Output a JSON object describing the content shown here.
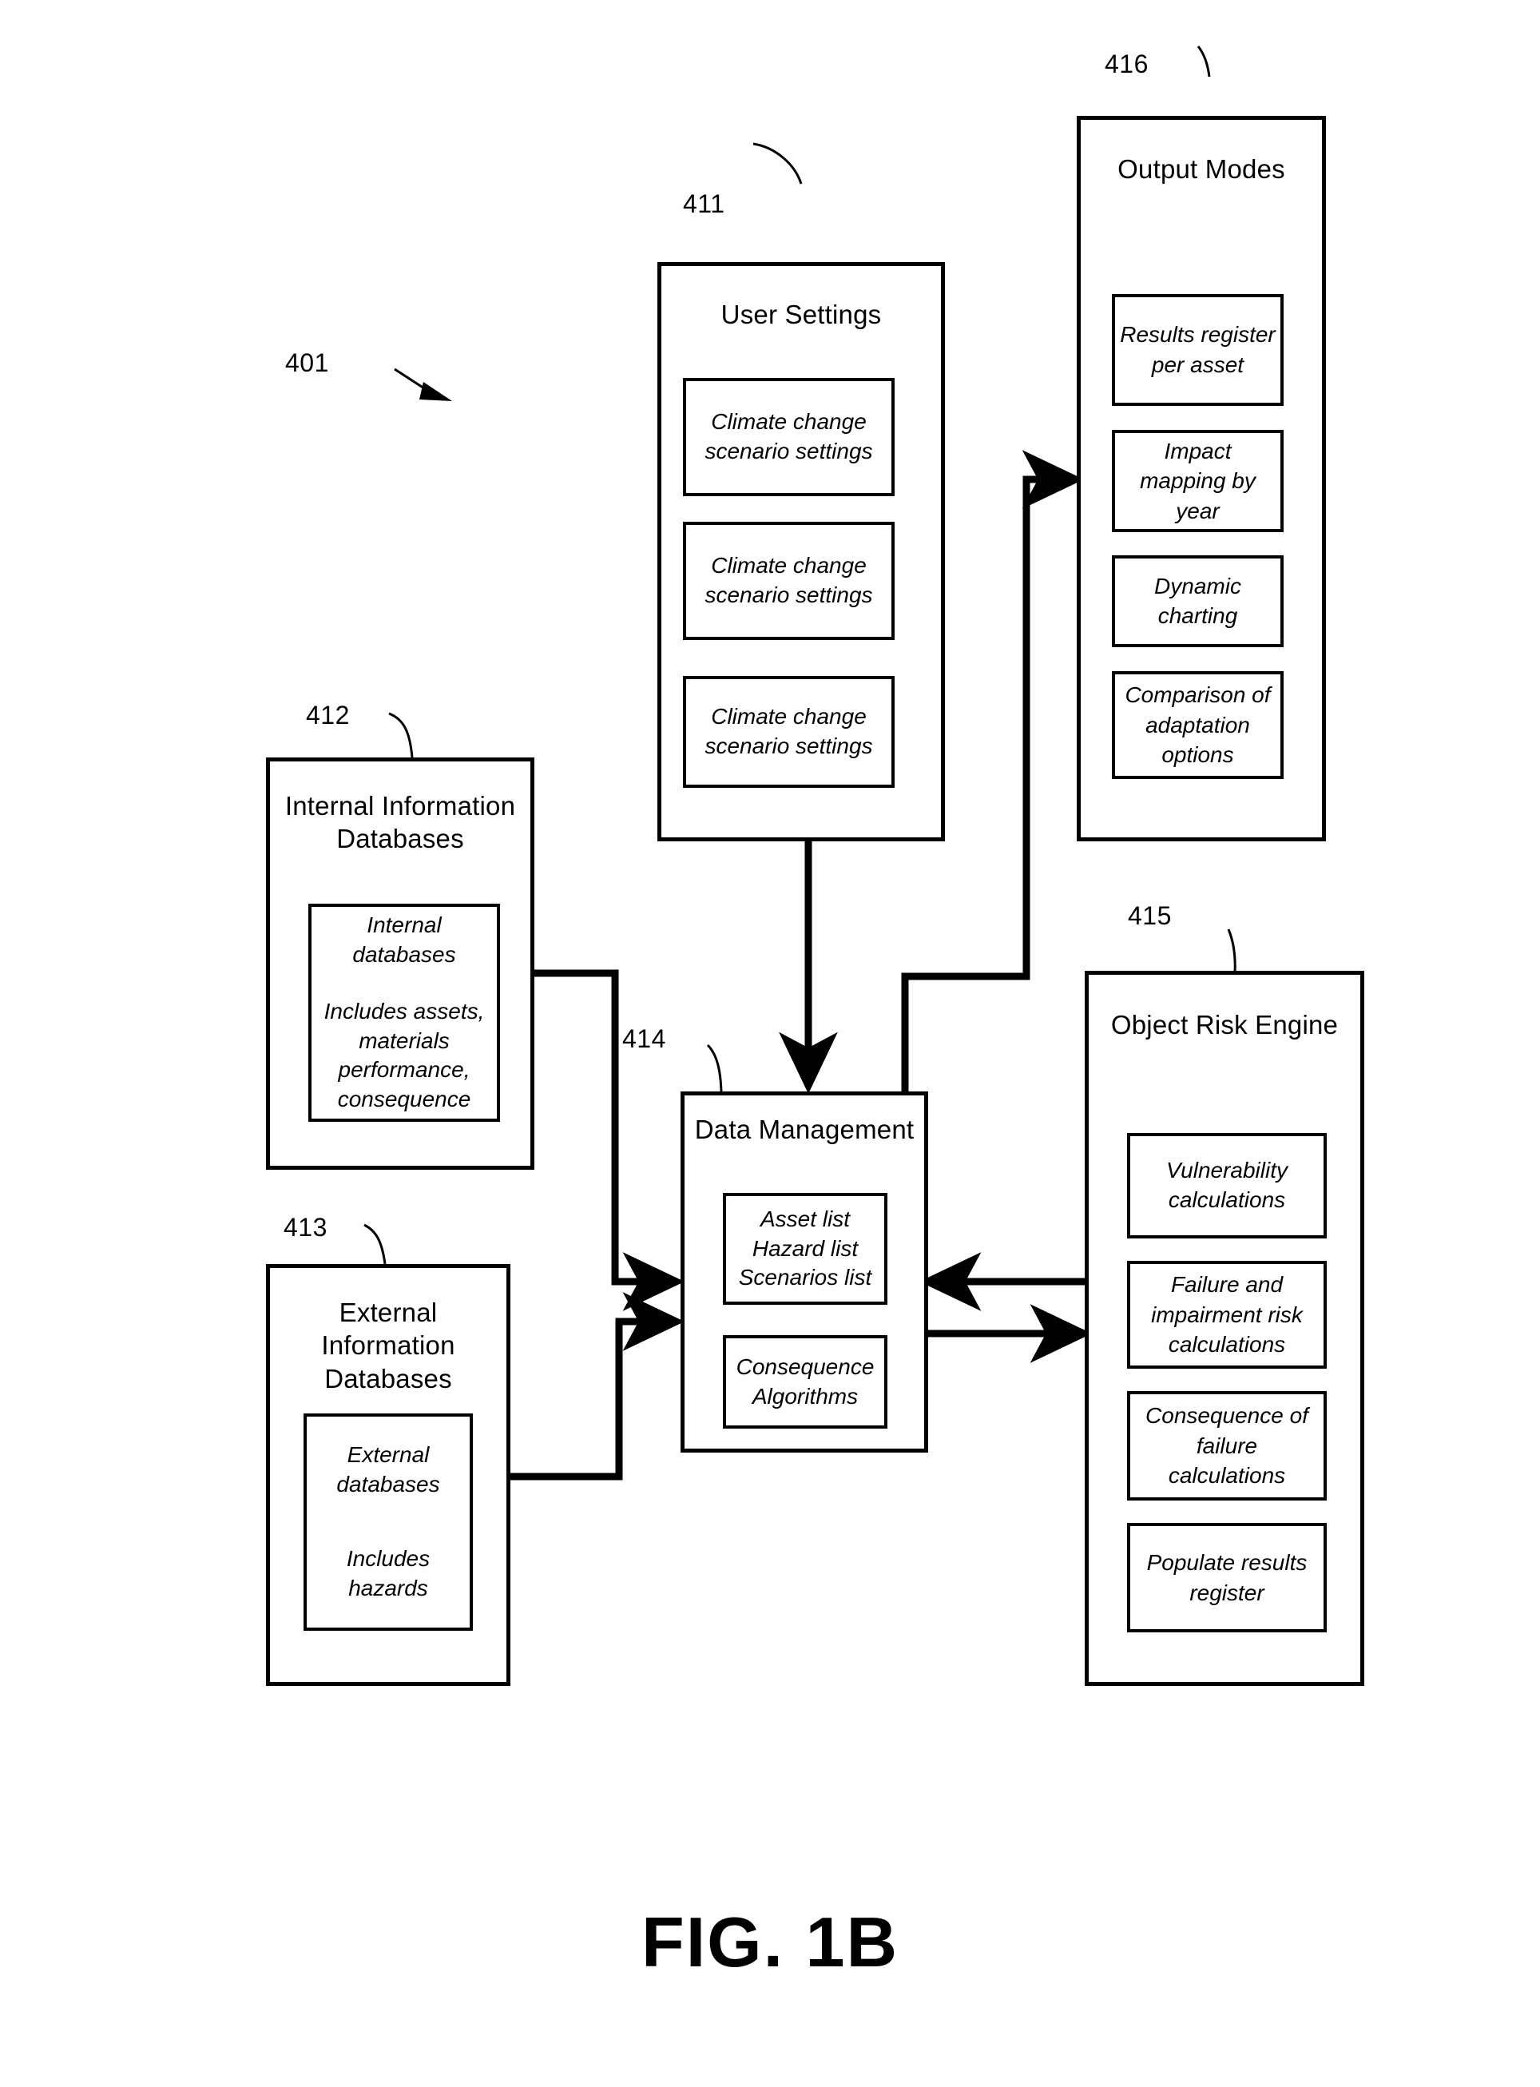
{
  "figure": {
    "caption": "FIG. 1B",
    "system_ref": "401"
  },
  "modules": {
    "user_settings": {
      "ref": "411",
      "title": "User Settings",
      "items": [
        "Climate change scenario settings",
        "Climate change scenario settings",
        "Climate change scenario settings"
      ]
    },
    "output_modes": {
      "ref": "416",
      "title": "Output Modes",
      "items": [
        "Results register per asset",
        "Impact mapping by year",
        "Dynamic charting",
        "Comparison of adaptation options"
      ]
    },
    "internal_databases": {
      "ref": "412",
      "title": "Internal Information Databases",
      "items": [
        "Internal databases\n\nIncludes assets, materials performance, consequence"
      ],
      "item_line1": "Internal databases",
      "item_line2": "Includes assets, materials performance, consequence"
    },
    "external_databases": {
      "ref": "413",
      "title": "External Information Databases",
      "items": [
        "External databases\n\nIncludes hazards"
      ],
      "item_line1": "External databases",
      "item_line2": "Includes hazards"
    },
    "data_management": {
      "ref": "414",
      "title": "Data Management",
      "items": [
        "Asset list Hazard list Scenarios list",
        "Consequence Algorithms"
      ],
      "list_line1": "Asset list",
      "list_line2": "Hazard list",
      "list_line3": "Scenarios list",
      "algorithms": "Consequence Algorithms"
    },
    "object_risk_engine": {
      "ref": "415",
      "title": "Object Risk Engine",
      "items": [
        "Vulnerability calculations",
        "Failure and impairment risk calculations",
        "Consequence of failure calculations",
        "Populate results register"
      ]
    }
  },
  "connections": [
    {
      "from": "user_settings",
      "to": "data_management",
      "arrow": "single"
    },
    {
      "from": "internal_databases",
      "to": "data_management",
      "arrow": "single"
    },
    {
      "from": "external_databases",
      "to": "data_management",
      "arrow": "single"
    },
    {
      "from": "data_management",
      "to": "output_modes",
      "arrow": "single"
    },
    {
      "from": "object_risk_engine",
      "to": "data_management",
      "arrow": "single"
    },
    {
      "from": "data_management",
      "to": "object_risk_engine",
      "arrow": "single"
    }
  ],
  "colors": {
    "line": "#000000",
    "background": "#ffffff"
  }
}
